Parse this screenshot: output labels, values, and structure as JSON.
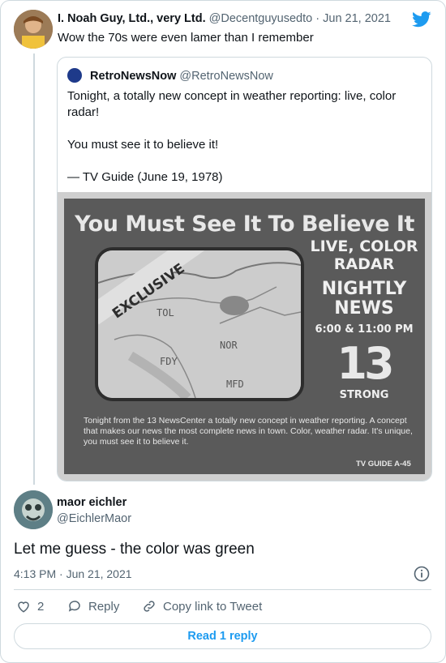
{
  "colors": {
    "accent": "#1d9bf0",
    "muted": "#536471",
    "border": "#cfd9de"
  },
  "tweet": {
    "author_name": "I. Noah Guy, Ltd., very Ltd.",
    "author_handle": "@Decentguyusedto",
    "date": "Jun 21, 2021",
    "text": "Wow the 70s were even lamer than I remember"
  },
  "quote": {
    "author_name": "RetroNewsNow",
    "author_handle": "@RetroNewsNow",
    "line1": "Tonight, a totally new concept in weather reporting: live, color radar!",
    "line2": "You must see it to believe it!",
    "line3": "— TV Guide (June 19, 1978)",
    "image": {
      "headline": "You Must See It To Believe It",
      "banner": "EXCLUSIVE",
      "map_labels": [
        "TOL",
        "NOR",
        "FDY",
        "MFD"
      ],
      "side1": "LIVE, COLOR RADAR",
      "side2": "NIGHTLY NEWS",
      "side3": "6:00 & 11:00 PM",
      "channel": "13",
      "channel_tag": "STRONG",
      "body": "Tonight from the 13 NewsCenter a totally new concept in weather reporting. A concept that makes our news the most complete news in town. Color, weather radar. It's unique, you must see it to believe it.",
      "footer": "TV GUIDE A-45"
    }
  },
  "reply": {
    "author_name": "maor eichler",
    "author_handle": "@EichlerMaor",
    "text": "Let me guess - the color was green",
    "time": "4:13 PM · Jun 21, 2021"
  },
  "actions": {
    "likes": "2",
    "reply_label": "Reply",
    "copy_label": "Copy link to Tweet",
    "read_replies": "Read 1 reply"
  },
  "icons": [
    "twitter-bird-icon",
    "heart-icon",
    "reply-icon",
    "link-icon",
    "info-icon"
  ]
}
